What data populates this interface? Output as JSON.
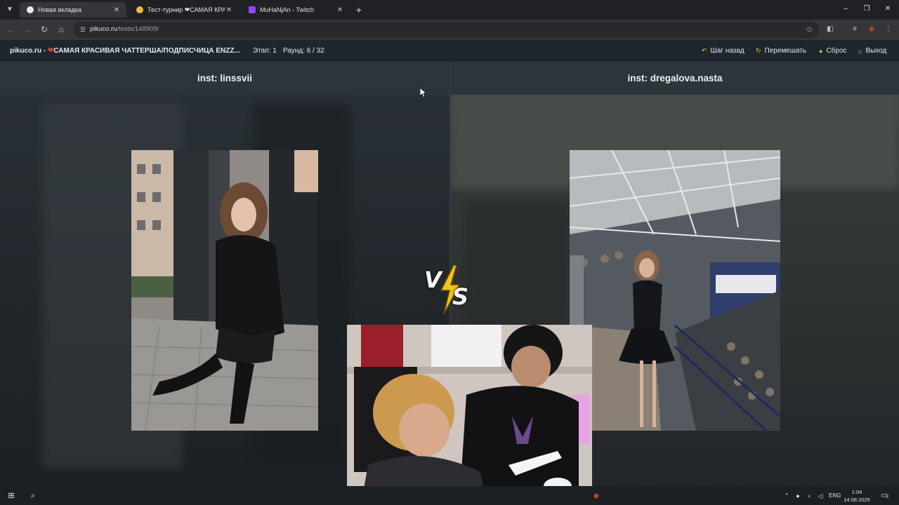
{
  "browser": {
    "tabs": [
      {
        "title": "Новая вкладка",
        "favicon_color": "#e8eaed",
        "active": true
      },
      {
        "title": "Тест-турнир ❤САМАЯ КРАСИ",
        "favicon_color": "#f0b93a",
        "active": false
      },
      {
        "title": "MuHaNjAn - Twitch",
        "favicon_color": "#9146ff",
        "active": false
      }
    ],
    "tab_search_icon": "chevron-down-icon",
    "new_tab_icon": "plus-icon",
    "window_controls": {
      "minimize": "–",
      "maximize": "❐",
      "close": "✕"
    },
    "url_host": "pikuco.ru",
    "url_path": "/tests/148909/"
  },
  "site": {
    "title": "pikuco.ru - ",
    "heart": "❤",
    "test_name": "САМАЯ КРАСИВАЯ ЧАТТЕРША/ПОДПИСЧИЦА ENZZ...",
    "stage": "Этап: 1",
    "round": "Раунд: 6 / 32",
    "actions": [
      {
        "label": "Шаг назад",
        "icon": "undo-icon"
      },
      {
        "label": "Перемешать",
        "icon": "shuffle-icon"
      },
      {
        "label": "Сброс",
        "icon": "reset-icon"
      },
      {
        "label": "Выход",
        "icon": "home-icon"
      }
    ],
    "accent_color": "#f0b93a"
  },
  "contestants": {
    "left": {
      "name": "inst: linssvii"
    },
    "right": {
      "name": "inst: dregalova.nasta"
    }
  },
  "vs": {
    "v": "V",
    "s": "S",
    "bolt_color": "#f5c518"
  },
  "taskbar": {
    "language": "ENG",
    "time": "1:04",
    "date": "14.08.2025",
    "notifications": "2"
  }
}
